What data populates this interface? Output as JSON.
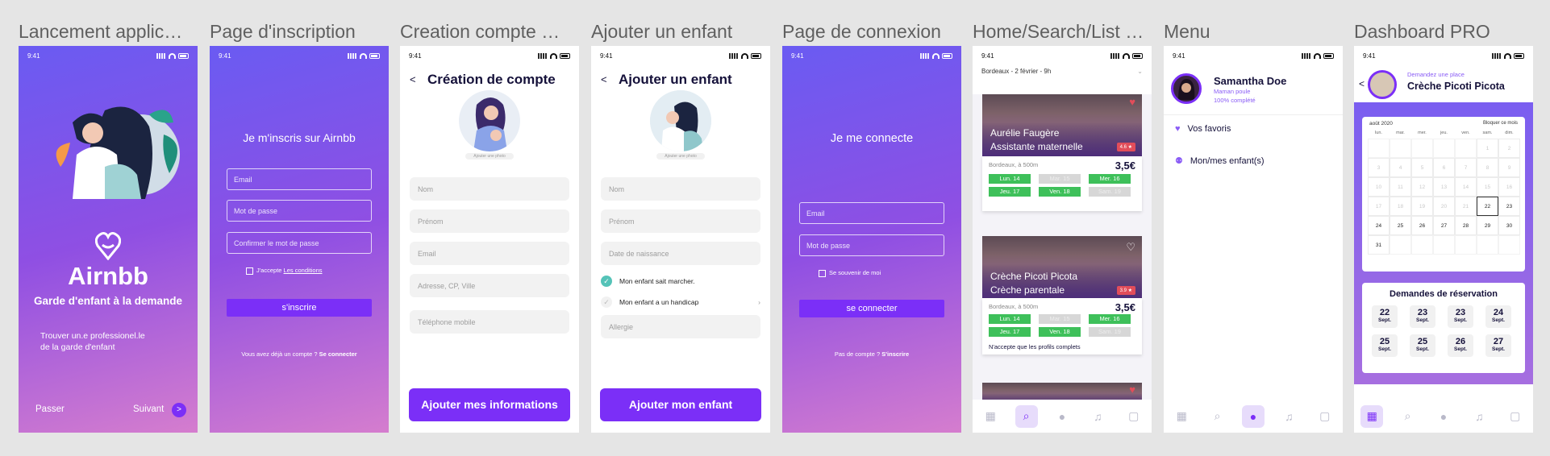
{
  "status_time": "9:41",
  "frames": {
    "launch": {
      "title": "Lancement applic…",
      "app_name": "Airnbb",
      "tagline": "Garde d'enfant à la demande",
      "desc_line1": "Trouver un.e professionel.le",
      "desc_line2": "de la garde d'enfant",
      "skip": "Passer",
      "next": "Suivant",
      "next_icon": ">"
    },
    "signup": {
      "title": "Page d'inscription",
      "heading": "Je m'inscris sur Airnbb",
      "email_ph": "Email",
      "password_ph": "Mot de passe",
      "confirm_ph": "Confirmer le mot de passe",
      "accept_text": "J'accepte",
      "conditions_link": "Les conditions",
      "button": "s'inscrire",
      "already_text": "Vous avez déjà un compte ?",
      "login_link": "Se connecter"
    },
    "create": {
      "title": "Creation compte …",
      "back": "<",
      "heading": "Création de compte",
      "photo_label": "Ajouter une photo",
      "fields": [
        "Nom",
        "Prénom",
        "Email",
        "Adresse, CP, Ville",
        "Téléphone mobile"
      ],
      "button": "Ajouter mes informations"
    },
    "child": {
      "title": "Ajouter un enfant",
      "back": "<",
      "heading": "Ajouter un enfant",
      "photo_label": "Ajouter une photo",
      "fields": [
        "Nom",
        "Prénom",
        "Date de naissance"
      ],
      "check1": "Mon enfant sait marcher.",
      "check2": "Mon enfant a un handicap",
      "chevron": "›",
      "allergy": "Allergie",
      "button": "Ajouter mon enfant"
    },
    "login": {
      "title": "Page de connexion",
      "heading": "Je me connecte",
      "email_ph": "Email",
      "password_ph": "Mot de passe",
      "remember": "Se souvenir de moi",
      "button": "se connecter",
      "no_account": "Pas de compte ?",
      "signup_link": "S'inscrire"
    },
    "home": {
      "title": "Home/Search/List …",
      "search": "Bordeaux - 2 février - 9h",
      "cards": [
        {
          "line1": "Aurélie Faugère",
          "line2": "Assistante maternelle",
          "rating": "4.6 ★",
          "location": "Bordeaux, à 500m",
          "price": "3,5€",
          "days": [
            {
              "label": "Lun. 14",
              "on": true
            },
            {
              "label": "Mar. 15",
              "on": false
            },
            {
              "label": "Mer. 16",
              "on": true
            },
            {
              "label": "Jeu. 17",
              "on": true
            },
            {
              "label": "Ven. 18",
              "on": true
            },
            {
              "label": "Sam. 19",
              "on": false
            }
          ]
        },
        {
          "line1": "Crèche Picoti Picota",
          "line2": "Crèche parentale",
          "rating": "3.9 ★",
          "location": "Bordeaux, à 500m",
          "price": "3,5€",
          "days": [
            {
              "label": "Lun. 14",
              "on": true
            },
            {
              "label": "Mar. 15",
              "on": false
            },
            {
              "label": "Mer. 16",
              "on": true
            },
            {
              "label": "Jeu. 17",
              "on": true
            },
            {
              "label": "Ven. 18",
              "on": true
            },
            {
              "label": "Sam. 19",
              "on": false
            }
          ],
          "note": "N'accepte que les profils complets"
        }
      ]
    },
    "menu": {
      "title": "Menu",
      "user_name": "Samantha Doe",
      "user_role": "Maman poule",
      "user_complete": "100% complété",
      "items": [
        "Vos favoris",
        "Mon/mes enfant(s)"
      ]
    },
    "dashboard": {
      "title": "Dashboard PRO",
      "back": "<",
      "request_label": "Demandez une place",
      "place_name": "Crèche Picoti Picota",
      "month": "août 2020",
      "block_month": "Bloquer ce mois",
      "weekdays": [
        "lun.",
        "mar.",
        "mer.",
        "jeu.",
        "ven.",
        "sam.",
        "dim."
      ],
      "calendar_rows": [
        [
          "",
          "",
          "",
          "",
          "",
          "1",
          "2"
        ],
        [
          "3",
          "4",
          "5",
          "6",
          "7",
          "8",
          "9"
        ],
        [
          "10",
          "11",
          "12",
          "13",
          "14",
          "15",
          "16"
        ],
        [
          "17",
          "18",
          "19",
          "20",
          "21",
          "22",
          "23"
        ],
        [
          "24",
          "25",
          "26",
          "27",
          "28",
          "29",
          "30"
        ],
        [
          "31",
          "",
          "",
          "",
          "",
          "",
          ""
        ]
      ],
      "selected_day": "22",
      "requests_title": "Demandes de réservation",
      "requests": [
        {
          "d": "22",
          "m": "Sept."
        },
        {
          "d": "23",
          "m": "Sept."
        },
        {
          "d": "23",
          "m": "Sept."
        },
        {
          "d": "24",
          "m": "Sept."
        },
        {
          "d": "25",
          "m": "Sept."
        },
        {
          "d": "25",
          "m": "Sept."
        },
        {
          "d": "26",
          "m": "Sept."
        },
        {
          "d": "27",
          "m": "Sept."
        }
      ]
    }
  },
  "colors": {
    "primary": "#7b2ff7",
    "gradient_start": "#6a5bf2",
    "gradient_end": "#d57dce",
    "available": "#3ec05a",
    "unavailable": "#d7d7d7",
    "rating": "#e24d5a"
  },
  "tab_icons": [
    "grid-icon",
    "search-icon",
    "user-icon",
    "bell-icon",
    "chat-icon"
  ]
}
